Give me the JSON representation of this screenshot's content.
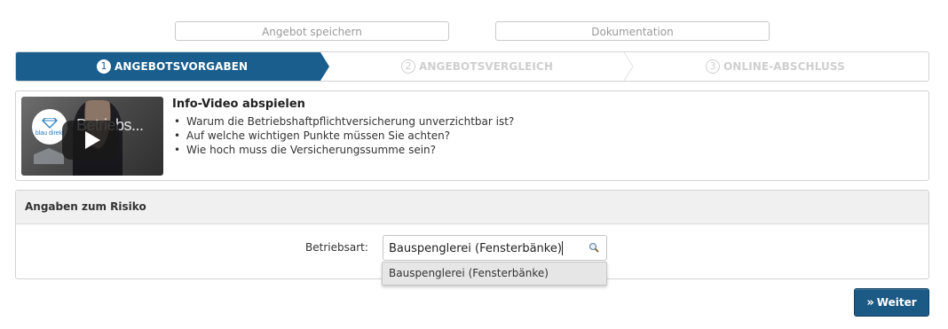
{
  "top_actions": {
    "save_offer": "Angebot speichern",
    "documentation": "Dokumentation"
  },
  "steps": [
    {
      "number": "1",
      "label": "ANGEBOTSVORGABEN",
      "state": "active"
    },
    {
      "number": "2",
      "label": "ANGEBOTSVERGLEICH",
      "state": "inactive"
    },
    {
      "number": "3",
      "label": "ONLINE-ABSCHLUSS",
      "state": "inactive"
    }
  ],
  "info_video": {
    "title": "Info-Video abspielen",
    "thumbnail_title": "Betriebs...",
    "logo_text": "blau direkt",
    "bullets": [
      "Warum die Betriebshaftpflichtversicherung unverzichtbar ist?",
      "Auf welche wichtigen Punkte müssen Sie achten?",
      "Wie hoch muss die Versicherungssumme sein?"
    ]
  },
  "risk_panel": {
    "title": "Angaben zum Risiko",
    "field_label": "Betriebsart:",
    "field_value": "Bauspenglerei (Fensterbänke)",
    "suggestions": [
      "Bauspenglerei (Fensterbänke)"
    ]
  },
  "next_button": {
    "label": "Weiter",
    "icon": "double-chevron-right-icon"
  },
  "colors": {
    "accent": "#1b5a85",
    "active_step": "#1a5e8e",
    "inactive_text": "#cfcfcf"
  }
}
